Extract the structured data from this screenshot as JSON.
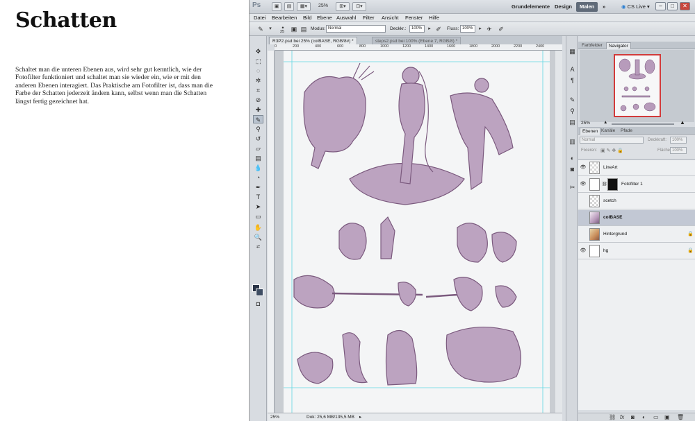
{
  "article": {
    "title": "Schatten",
    "body": "Schaltet man die unteren Ebenen aus, wird sehr gut kenntlich, wie der Fotofilter funktioniert und schaltet man sie wieder ein, wie er mit den anderen Ebenen interagiert. Das Praktische am Fotofilter ist, dass man die Farbe der Schatten jederzeit ändern kann, selbst wenn man die Schatten längst fertig gezeichnet hat."
  },
  "app": {
    "logo": "Ps",
    "zoom_display": "25%",
    "workspaces": [
      "Grundelemente",
      "Design",
      "Malen"
    ],
    "active_workspace": "Malen",
    "more": "»",
    "cs_live": "CS Live",
    "window_buttons": [
      "–",
      "□",
      "✕"
    ]
  },
  "menu": [
    "Datei",
    "Bearbeiten",
    "Bild",
    "Ebene",
    "Auswahl",
    "Filter",
    "Ansicht",
    "Fenster",
    "Hilfe"
  ],
  "options": {
    "brush_size": "25",
    "mode_label": "Modus:",
    "mode_value": "Normal",
    "opacity_label": "Deckkr.:",
    "opacity_value": "100%",
    "flow_label": "Fluss:",
    "flow_value": "100%"
  },
  "documents": {
    "tabs": [
      "R3P2.psd bei 25% (colBASE, RGB/8#) *",
      "steps2.psd bei 100% (Ebene 7, RGB/8) *"
    ],
    "ruler_ticks": [
      "0",
      "200",
      "400",
      "600",
      "800",
      "1000",
      "1200",
      "1400",
      "1600",
      "1800",
      "2000",
      "2200",
      "2400"
    ],
    "status_zoom": "25%",
    "status_doc": "Dok: 25,6 MB/135,5 MB"
  },
  "panels": {
    "top_tabs": [
      "Farbfelder",
      "Navigator"
    ],
    "active_top": "Navigator",
    "nav_zoom": "25%",
    "layer_tabs": [
      "Ebenen",
      "Kanäle",
      "Pfade"
    ],
    "active_layer_tab": "Ebenen",
    "blend_mode": "Normal",
    "opacity_label": "Deckkraft:",
    "opacity_value": "100%",
    "lock_label": "Fixieren:",
    "fill_label": "Fläche:",
    "fill_value": "100%",
    "layers": [
      {
        "name": "LineArt",
        "visible": true,
        "thumb": "transparent",
        "selected": false,
        "bold": false,
        "locked": false
      },
      {
        "name": "Fotofilter 1",
        "visible": true,
        "thumb": "adjust",
        "selected": false,
        "bold": false,
        "locked": false
      },
      {
        "name": "scetch",
        "visible": false,
        "thumb": "transparent",
        "selected": false,
        "bold": false,
        "locked": false
      },
      {
        "name": "colBASE",
        "visible": false,
        "thumb": "art2",
        "selected": true,
        "bold": true,
        "locked": false
      },
      {
        "name": "Hintergrund",
        "visible": false,
        "thumb": "art",
        "selected": false,
        "bold": false,
        "locked": true
      },
      {
        "name": "hg",
        "visible": true,
        "thumb": "white",
        "selected": false,
        "bold": false,
        "locked": true
      }
    ]
  },
  "colors": {
    "sketch_purple": "#6e4a72",
    "sketch_light": "#b79bbb",
    "guide": "#5fd6e3",
    "nav_frame": "#d23a3a"
  }
}
